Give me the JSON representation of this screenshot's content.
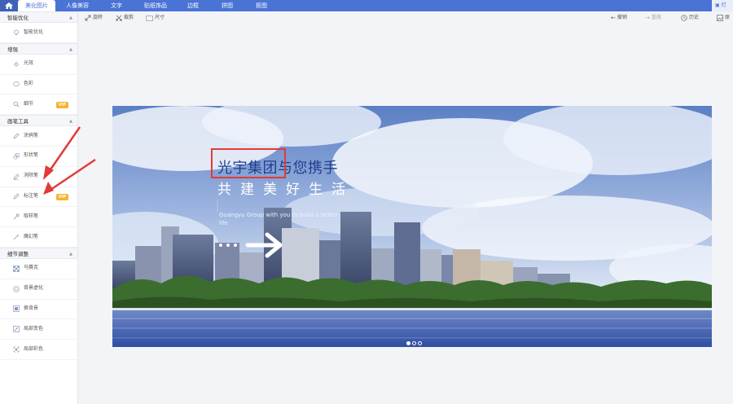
{
  "nav": {
    "tabs": [
      {
        "label": "美化图片",
        "active": true
      },
      {
        "label": "人像美容"
      },
      {
        "label": "文字"
      },
      {
        "label": "贴纸饰品"
      },
      {
        "label": "边框"
      },
      {
        "label": "拼图"
      },
      {
        "label": "抠图"
      }
    ],
    "open_label": "打"
  },
  "toolbar": {
    "rotate": "旋转",
    "crop": "裁剪",
    "size": "尺寸",
    "undo": "撤销",
    "redo": "重做",
    "history": "历史",
    "original": "原"
  },
  "sidebar": {
    "sections": [
      {
        "title": "智能优化",
        "items": [
          {
            "label": "智能优化",
            "icon": "smart-icon"
          }
        ]
      },
      {
        "title": "增强",
        "items": [
          {
            "label": "光效",
            "icon": "light-icon"
          },
          {
            "label": "色彩",
            "icon": "color-icon"
          },
          {
            "label": "细节",
            "icon": "detail-icon",
            "vip": "VIP"
          }
        ]
      },
      {
        "title": "画笔工具",
        "items": [
          {
            "label": "涂鸦笔",
            "icon": "doodle-icon"
          },
          {
            "label": "形状笔",
            "icon": "shape-icon"
          },
          {
            "label": "消除笔",
            "icon": "eraser-icon"
          },
          {
            "label": "标注笔",
            "icon": "mark-icon",
            "vip": "VIP"
          },
          {
            "label": "取样笔",
            "icon": "sample-icon"
          },
          {
            "label": "魔幻笔",
            "icon": "magic-icon"
          }
        ]
      },
      {
        "title": "细节调整",
        "items": [
          {
            "label": "马赛克",
            "icon": "mosaic-icon"
          },
          {
            "label": "背景虚化",
            "icon": "blur-icon"
          },
          {
            "label": "换背景",
            "icon": "bg-icon"
          },
          {
            "label": "局部变色",
            "icon": "recolor-icon"
          },
          {
            "label": "局部彩色",
            "icon": "partial-color-icon"
          }
        ]
      }
    ]
  },
  "banner": {
    "title": "光宇集团与您携手",
    "slogan": "共建美好生活",
    "subtext": "Guangyu Group with you to build a better life"
  },
  "colors": {
    "nav": "#4a73d6",
    "vip": "#f5b32a",
    "highlight": "#e33a36",
    "annotation_arrow": "#e33a36"
  }
}
